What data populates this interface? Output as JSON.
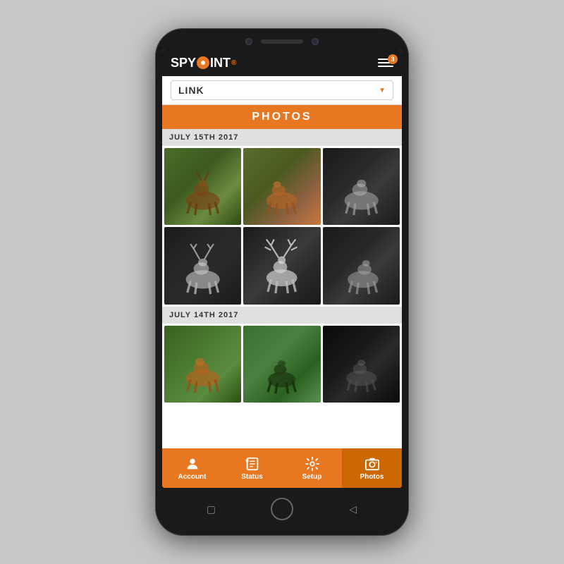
{
  "phone": {
    "header": {
      "logo": "SPYPOINT",
      "menu_badge": "3"
    },
    "camera_selector": {
      "current": "LINK",
      "arrow": "▼"
    },
    "section_title": "PHOTOS",
    "dates": [
      {
        "label": "JULY 15TH 2017",
        "photos": [
          {
            "id": "p1",
            "style": "color1",
            "alt": "deer daytime 1"
          },
          {
            "id": "p2",
            "style": "color2",
            "alt": "deer daytime 2"
          },
          {
            "id": "p3",
            "style": "night1",
            "alt": "deer night 1"
          },
          {
            "id": "p4",
            "style": "night2",
            "alt": "deer night 2"
          },
          {
            "id": "p5",
            "style": "night3",
            "alt": "deer night 3"
          },
          {
            "id": "p6",
            "style": "night4",
            "alt": "deer night 4"
          }
        ]
      },
      {
        "label": "JULY 14TH 2017",
        "photos": [
          {
            "id": "p7",
            "style": "color3",
            "alt": "deer daytime 3"
          },
          {
            "id": "p8",
            "style": "color4",
            "alt": "deer daytime 4"
          },
          {
            "id": "p9",
            "style": "night5",
            "alt": "deer night 5"
          }
        ]
      }
    ],
    "bottom_nav": [
      {
        "id": "account",
        "label": "Account",
        "active": false
      },
      {
        "id": "status",
        "label": "Status",
        "active": false
      },
      {
        "id": "setup",
        "label": "Setup",
        "active": false
      },
      {
        "id": "photos",
        "label": "Photos",
        "active": true
      }
    ],
    "phone_nav_buttons": [
      "▢",
      "○",
      "◁"
    ]
  }
}
